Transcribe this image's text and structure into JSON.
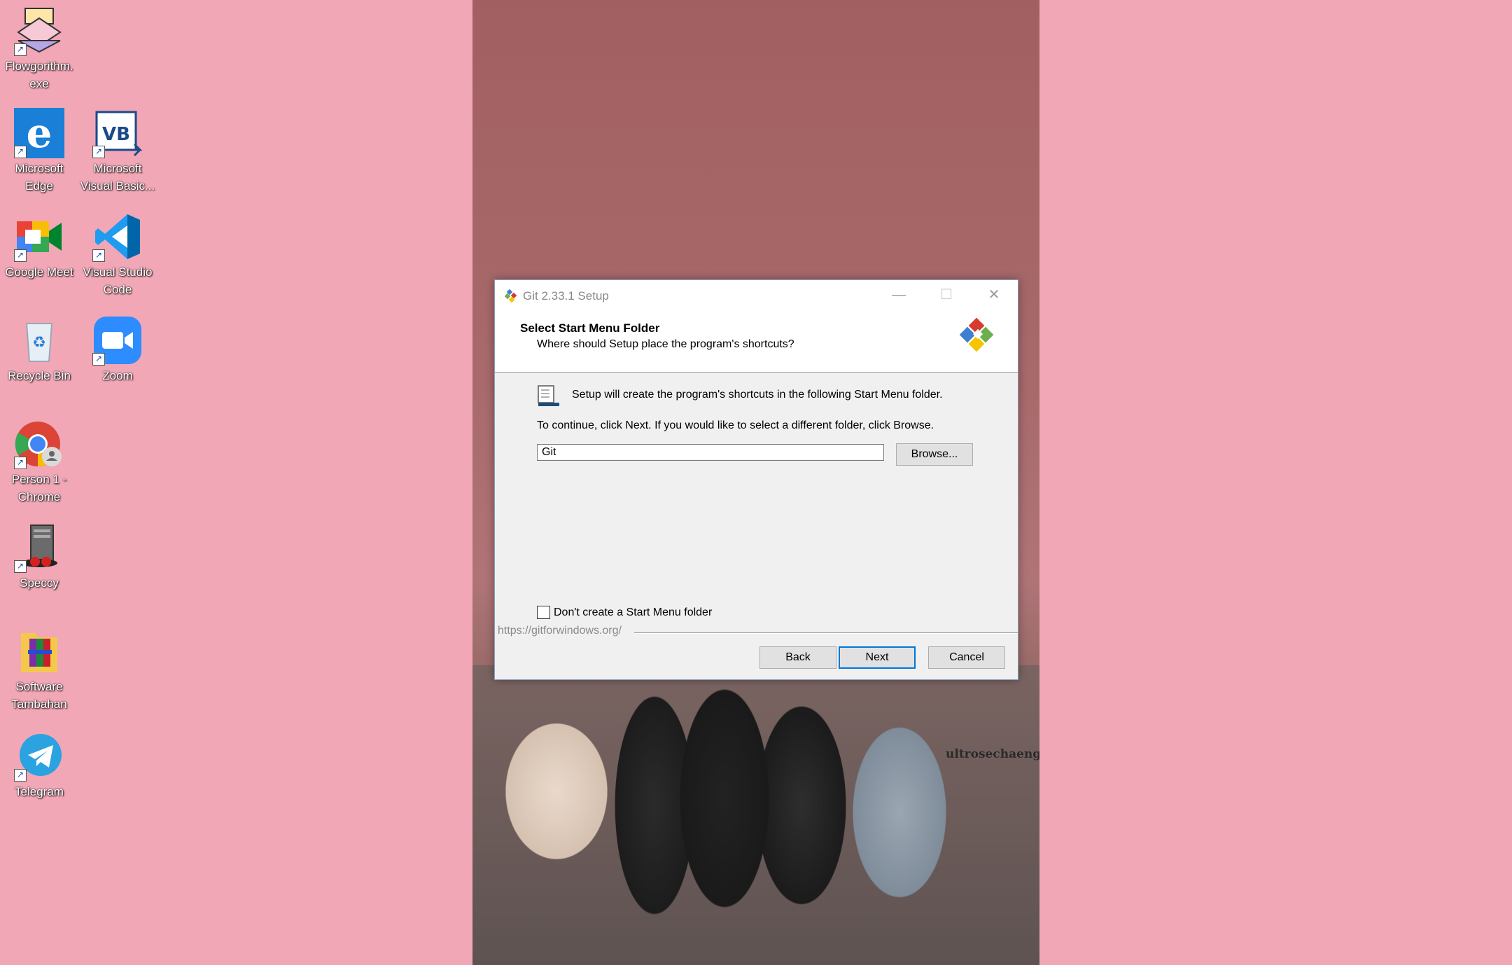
{
  "desktop": {
    "icons": [
      {
        "label": "Flowgorithm.\nexe",
        "icon": "flowgorithm-icon"
      },
      {
        "label": "Microsoft\nEdge",
        "icon": "edge-icon"
      },
      {
        "label": "Microsoft\nVisual Basic...",
        "icon": "visual-basic-icon"
      },
      {
        "label": "Google Meet",
        "icon": "google-meet-icon"
      },
      {
        "label": "Visual Studio\nCode",
        "icon": "vscode-icon"
      },
      {
        "label": "Recycle Bin",
        "icon": "recycle-bin-icon"
      },
      {
        "label": "Zoom",
        "icon": "zoom-icon"
      },
      {
        "label": "Person 1 -\nChrome",
        "icon": "chrome-icon"
      },
      {
        "label": "Speccy",
        "icon": "speccy-icon"
      },
      {
        "label": "Software\nTambahan",
        "icon": "winrar-folder-icon"
      },
      {
        "label": "Telegram",
        "icon": "telegram-icon"
      }
    ]
  },
  "wallpaper": {
    "watermark": "ultrosechaeng."
  },
  "dialog": {
    "title": "Git 2.33.1 Setup",
    "heading": "Select Start Menu Folder",
    "subheading": "Where should Setup place the program's shortcuts?",
    "intro": "Setup will create the program's shortcuts in the following Start Menu folder.",
    "instruction": "To continue, click Next. If you would like to select a different folder, click Browse.",
    "folder_value": "Git",
    "browse_label": "Browse...",
    "checkbox_label": "Don't create a Start Menu folder",
    "checkbox_checked": false,
    "footer_url": "https://gitforwindows.org/",
    "back_label": "Back",
    "next_label": "Next",
    "cancel_label": "Cancel",
    "minimize_symbol": "—",
    "maximize_symbol": "☐",
    "close_symbol": "✕"
  },
  "colors": {
    "desktop_bg": "#f1a7b6",
    "accent": "#0078d7"
  }
}
